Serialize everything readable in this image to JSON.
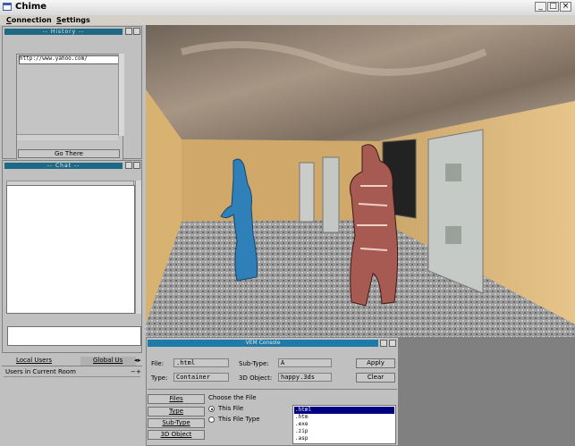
{
  "window": {
    "title": "Chime"
  },
  "menu": [
    {
      "label": "Connection",
      "underline": "C",
      "rest": "onnection"
    },
    {
      "label": "Settings",
      "underline": "S",
      "rest": "ettings"
    }
  ],
  "history": {
    "title": "-- History --",
    "items": [
      "http://www.yahoo.com/"
    ],
    "go_button": "Go There"
  },
  "chat": {
    "title": "-- Chat --",
    "message_input": ""
  },
  "users": {
    "tabs": [
      "Local Users",
      "Global Us"
    ],
    "header": "Users in Current Room"
  },
  "console": {
    "title": "VEM Console",
    "file_label": "File:",
    "file_value": ".html",
    "subtype_label": "Sub-Type:",
    "subtype_value": "A",
    "type_label": "Type:",
    "type_value": "Container",
    "object3d_label": "3D Object:",
    "object3d_value": "happy.3ds",
    "apply_button": "Apply",
    "clear_button": "Clear",
    "tabs": [
      "Files",
      "Type",
      "Sub-Type",
      "3D Object"
    ],
    "choose_label": "Choose the File",
    "radio_this_file": "This File",
    "radio_this_type": "This File Type",
    "file_types": [
      ".html",
      ".htm",
      ".exe",
      ".zip",
      ".asp"
    ],
    "selected_file_type": ".html"
  },
  "colors": {
    "panel_header": "#1e6a86",
    "console_header": "#1e7aa8",
    "selection": "#000080"
  }
}
